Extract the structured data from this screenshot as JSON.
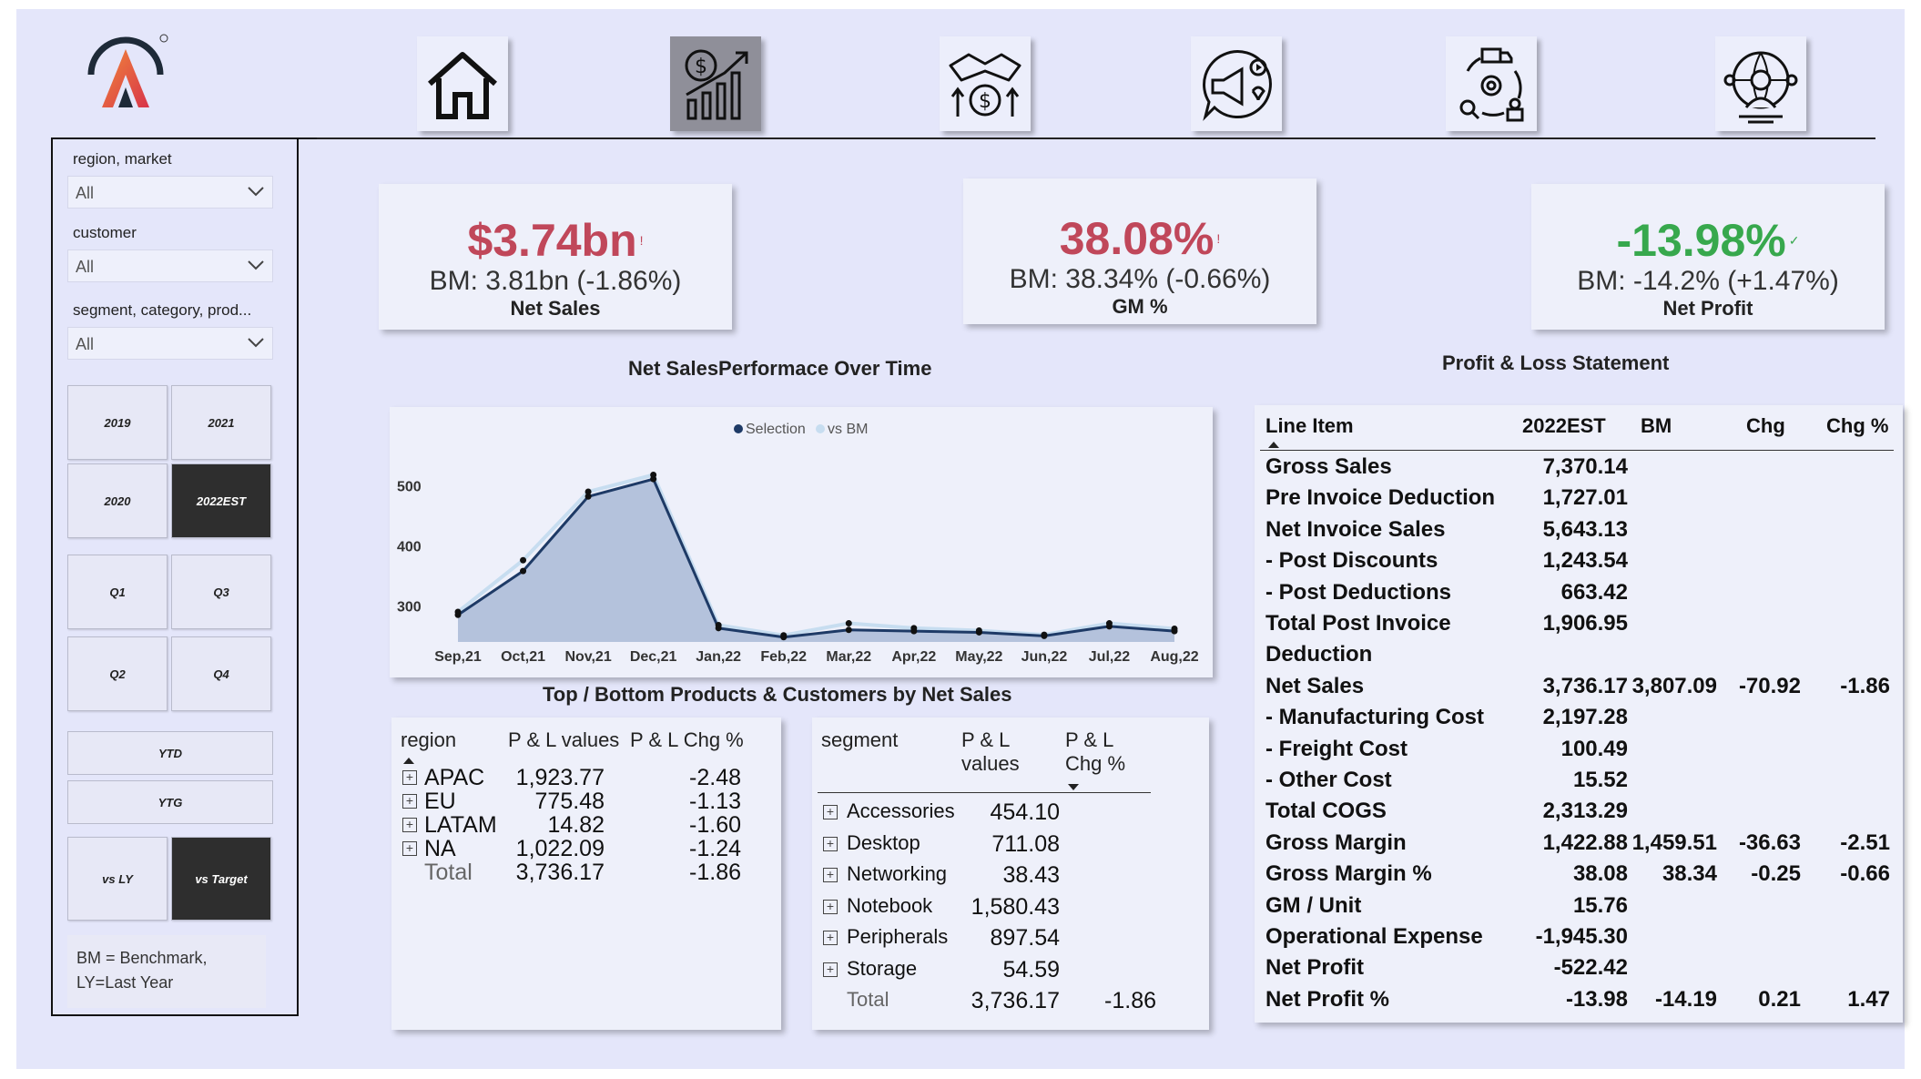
{
  "nav": {
    "items": [
      {
        "name": "home",
        "icon": "house-icon"
      },
      {
        "name": "finance",
        "icon": "dollar-growth-chart-icon",
        "active": true
      },
      {
        "name": "sales",
        "icon": "handshake-dollar-icon"
      },
      {
        "name": "marketing",
        "icon": "megaphone-thumbs-up-icon"
      },
      {
        "name": "supply-chain",
        "icon": "truck-gear-cycle-icon"
      },
      {
        "name": "executive",
        "icon": "globe-person-icon"
      }
    ]
  },
  "sidebar": {
    "slicers": [
      {
        "label": "region, market",
        "value": "All"
      },
      {
        "label": "customer",
        "value": "All"
      },
      {
        "label": "segment, category, prod...",
        "value": "All"
      }
    ],
    "years": [
      "2019",
      "2021",
      "2020",
      "2022EST"
    ],
    "selected_year": "2022EST",
    "quarters": [
      "Q1",
      "Q3",
      "Q2",
      "Q4"
    ],
    "ytd": "YTD",
    "ytg": "YTG",
    "compare": [
      "vs LY",
      "vs Target"
    ],
    "selected_compare": "vs Target",
    "note": "BM = Benchmark, LY=Last Year"
  },
  "kpis": {
    "net_sales": {
      "value": "$3.74bn",
      "bm": "BM: 3.81bn (-1.86%)",
      "label": "Net Sales",
      "flag": "!"
    },
    "gm": {
      "value": "38.08%",
      "bm": "BM: 38.34% (-0.66%)",
      "label": "GM %",
      "flag": "!"
    },
    "net_profit": {
      "value": "-13.98%",
      "bm": "BM: -14.2% (+1.47%)",
      "label": "Net Profit",
      "flag": "✓"
    }
  },
  "colors": {
    "negative": "#c0475a",
    "positive": "#37a84d",
    "selection_line": "#1e3a66",
    "area_fill": "#a9bad6",
    "bm_line": "#c7ddf0"
  },
  "chart_title": "Net SalesPerformace Over Time",
  "chart_data": {
    "type": "area",
    "legend": [
      "Selection",
      "vs BM"
    ],
    "legend_position": "top-center",
    "categories": [
      "Sep,21",
      "Oct,21",
      "Nov,21",
      "Dec,21",
      "Jan,22",
      "Feb,22",
      "Mar,22",
      "Apr,22",
      "May,22",
      "Jun,22",
      "Jul,22",
      "Aug,22"
    ],
    "yticks": [
      "300",
      "400",
      "500"
    ],
    "ylim": [
      240,
      540
    ],
    "series": [
      {
        "name": "Selection",
        "values": [
          285,
          358,
          482,
          511,
          263,
          248,
          260,
          258,
          256,
          250,
          266,
          258
        ]
      },
      {
        "name": "vs BM",
        "values": [
          290,
          376,
          490,
          518,
          268,
          251,
          271,
          263,
          259,
          252,
          271,
          262
        ]
      }
    ]
  },
  "top_bottom_title": "Top / Bottom Products & Customers by Net Sales",
  "region_table": {
    "headers": [
      "region",
      "P & L values",
      "P & L Chg %"
    ],
    "rows": [
      {
        "name": "APAC",
        "value": "1,923.77",
        "chg": "-2.48"
      },
      {
        "name": "EU",
        "value": "775.48",
        "chg": "-1.13"
      },
      {
        "name": "LATAM",
        "value": "14.82",
        "chg": "-1.60"
      },
      {
        "name": "NA",
        "value": "1,022.09",
        "chg": "-1.24"
      }
    ],
    "total": {
      "name": "Total",
      "value": "3,736.17",
      "chg": "-1.86"
    }
  },
  "segment_table": {
    "headers": [
      "segment",
      "P & L",
      "values",
      "P & L",
      "Chg %"
    ],
    "rows": [
      {
        "name": "Accessories",
        "value": "454.10"
      },
      {
        "name": "Desktop",
        "value": "711.08"
      },
      {
        "name": "Networking",
        "value": "38.43"
      },
      {
        "name": "Notebook",
        "value": "1,580.43"
      },
      {
        "name": "Peripherals",
        "value": "897.54"
      },
      {
        "name": "Storage",
        "value": "54.59"
      }
    ],
    "total": {
      "name": "Total",
      "value": "3,736.17",
      "chg": "-1.86"
    }
  },
  "pl_title": "Profit & Loss Statement",
  "pl": {
    "headers": [
      "Line Item",
      "2022EST",
      "BM",
      "Chg",
      "Chg %"
    ],
    "rows": [
      {
        "item": "Gross Sales",
        "est": "7,370.14",
        "bm": "",
        "chg": "",
        "pct": ""
      },
      {
        "item": "Pre Invoice Deduction",
        "est": "1,727.01",
        "bm": "",
        "chg": "",
        "pct": ""
      },
      {
        "item": "Net Invoice Sales",
        "est": "5,643.13",
        "bm": "",
        "chg": "",
        "pct": ""
      },
      {
        "item": "- Post Discounts",
        "est": "1,243.54",
        "bm": "",
        "chg": "",
        "pct": ""
      },
      {
        "item": "- Post Deductions",
        "est": "663.42",
        "bm": "",
        "chg": "",
        "pct": ""
      },
      {
        "item": "Total Post Invoice",
        "est": "1,906.95",
        "bm": "",
        "chg": "",
        "pct": ""
      },
      {
        "item": "Deduction",
        "est": "",
        "bm": "",
        "chg": "",
        "pct": ""
      },
      {
        "item": "Net Sales",
        "est": "3,736.17",
        "bm": "3,807.09",
        "chg": "-70.92",
        "pct": "-1.86"
      },
      {
        "item": "- Manufacturing Cost",
        "est": "2,197.28",
        "bm": "",
        "chg": "",
        "pct": ""
      },
      {
        "item": "- Freight Cost",
        "est": "100.49",
        "bm": "",
        "chg": "",
        "pct": ""
      },
      {
        "item": "- Other Cost",
        "est": "15.52",
        "bm": "",
        "chg": "",
        "pct": ""
      },
      {
        "item": "Total COGS",
        "est": "2,313.29",
        "bm": "",
        "chg": "",
        "pct": ""
      },
      {
        "item": "Gross Margin",
        "est": "1,422.88",
        "bm": "1,459.51",
        "chg": "-36.63",
        "pct": "-2.51"
      },
      {
        "item": "Gross Margin %",
        "est": "38.08",
        "bm": "38.34",
        "chg": "-0.25",
        "pct": "-0.66"
      },
      {
        "item": "GM / Unit",
        "est": "15.76",
        "bm": "",
        "chg": "",
        "pct": ""
      },
      {
        "item": "Operational Expense",
        "est": "-1,945.30",
        "bm": "",
        "chg": "",
        "pct": ""
      },
      {
        "item": "Net Profit",
        "est": "-522.42",
        "bm": "",
        "chg": "",
        "pct": ""
      },
      {
        "item": "Net Profit %",
        "est": "-13.98",
        "bm": "-14.19",
        "chg": "0.21",
        "pct": "1.47"
      }
    ]
  }
}
